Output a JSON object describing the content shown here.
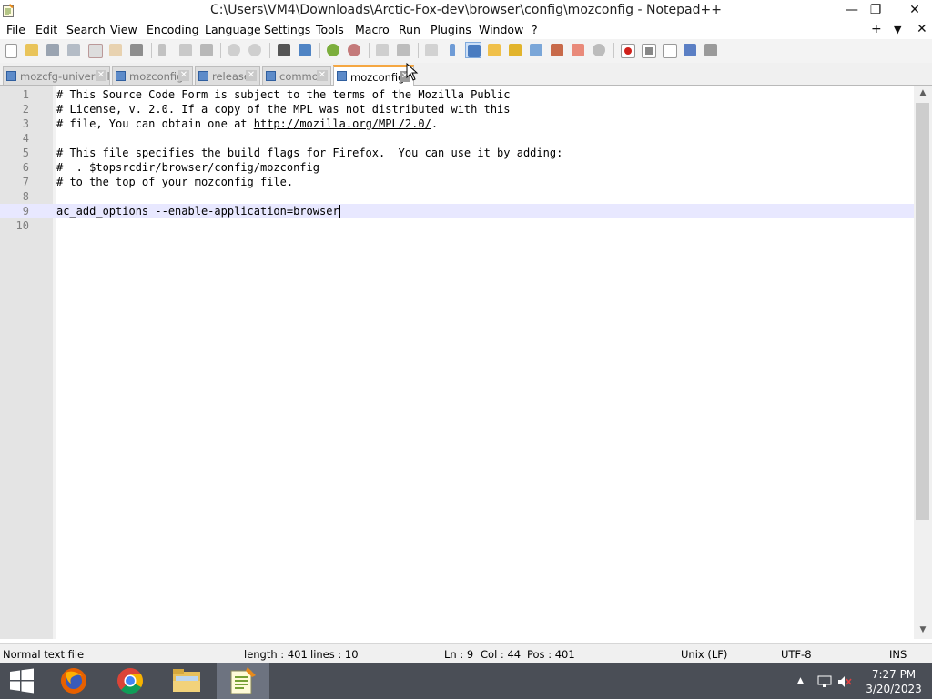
{
  "window": {
    "title": "C:\\Users\\VM4\\Downloads\\Arctic-Fox-dev\\browser\\config\\mozconfig - Notepad++",
    "minimize_glyph": "—",
    "restore_glyph": "❐",
    "close_glyph": "✕"
  },
  "menu": {
    "items": [
      "File",
      "Edit",
      "Search",
      "View",
      "Encoding",
      "Language",
      "Settings",
      "Tools",
      "Macro",
      "Run",
      "Plugins",
      "Window",
      "?"
    ],
    "right": {
      "plus": "+",
      "dropdown": "▼",
      "close": "✕"
    }
  },
  "tabs": [
    {
      "label": "mozcfg-universal",
      "active": false
    },
    {
      "label": "mozconfig",
      "active": false
    },
    {
      "label": "release",
      "active": false
    },
    {
      "label": "common",
      "active": false
    },
    {
      "label": "mozconfig",
      "active": true
    }
  ],
  "tab_close_glyph": "✕",
  "editor": {
    "current_line": 9,
    "lines": [
      {
        "n": "1",
        "text": "# This Source Code Form is subject to the terms of the Mozilla Public"
      },
      {
        "n": "2",
        "text": "# License, v. 2.0. If a copy of the MPL was not distributed with this"
      },
      {
        "n": "3",
        "pre": "# file, You can obtain one at ",
        "url": "http://mozilla.org/MPL/2.0/",
        "post": "."
      },
      {
        "n": "4",
        "text": ""
      },
      {
        "n": "5",
        "text": "# This file specifies the build flags for Firefox.  You can use it by adding:"
      },
      {
        "n": "6",
        "text": "#  . $topsrcdir/browser/config/mozconfig"
      },
      {
        "n": "7",
        "text": "# to the top of your mozconfig file."
      },
      {
        "n": "8",
        "text": ""
      },
      {
        "n": "9",
        "text": "ac_add_options --enable-application=browser"
      },
      {
        "n": "10",
        "text": ""
      }
    ]
  },
  "scrollbar": {
    "up": "▲",
    "down": "▼"
  },
  "status": {
    "type": "Normal text file",
    "length": "length : 401",
    "lines": "lines : 10",
    "ln": "Ln : 9",
    "col": "Col : 44",
    "pos": "Pos : 401",
    "eol": "Unix (LF)",
    "encoding": "UTF-8",
    "mode": "INS"
  },
  "taskbar": {
    "apps": [
      "windows-start",
      "firefox",
      "chrome",
      "file-explorer",
      "notepad-plus-plus"
    ],
    "tray_arrow": "▲",
    "time": "7:27 PM",
    "date": "3/20/2023"
  },
  "colors": {
    "tab_accent": "#f5a742",
    "current_line_bg": "#e8e8ff",
    "gutter_bg": "#e4e4e4",
    "taskbar_bg": "#4a4e56"
  }
}
